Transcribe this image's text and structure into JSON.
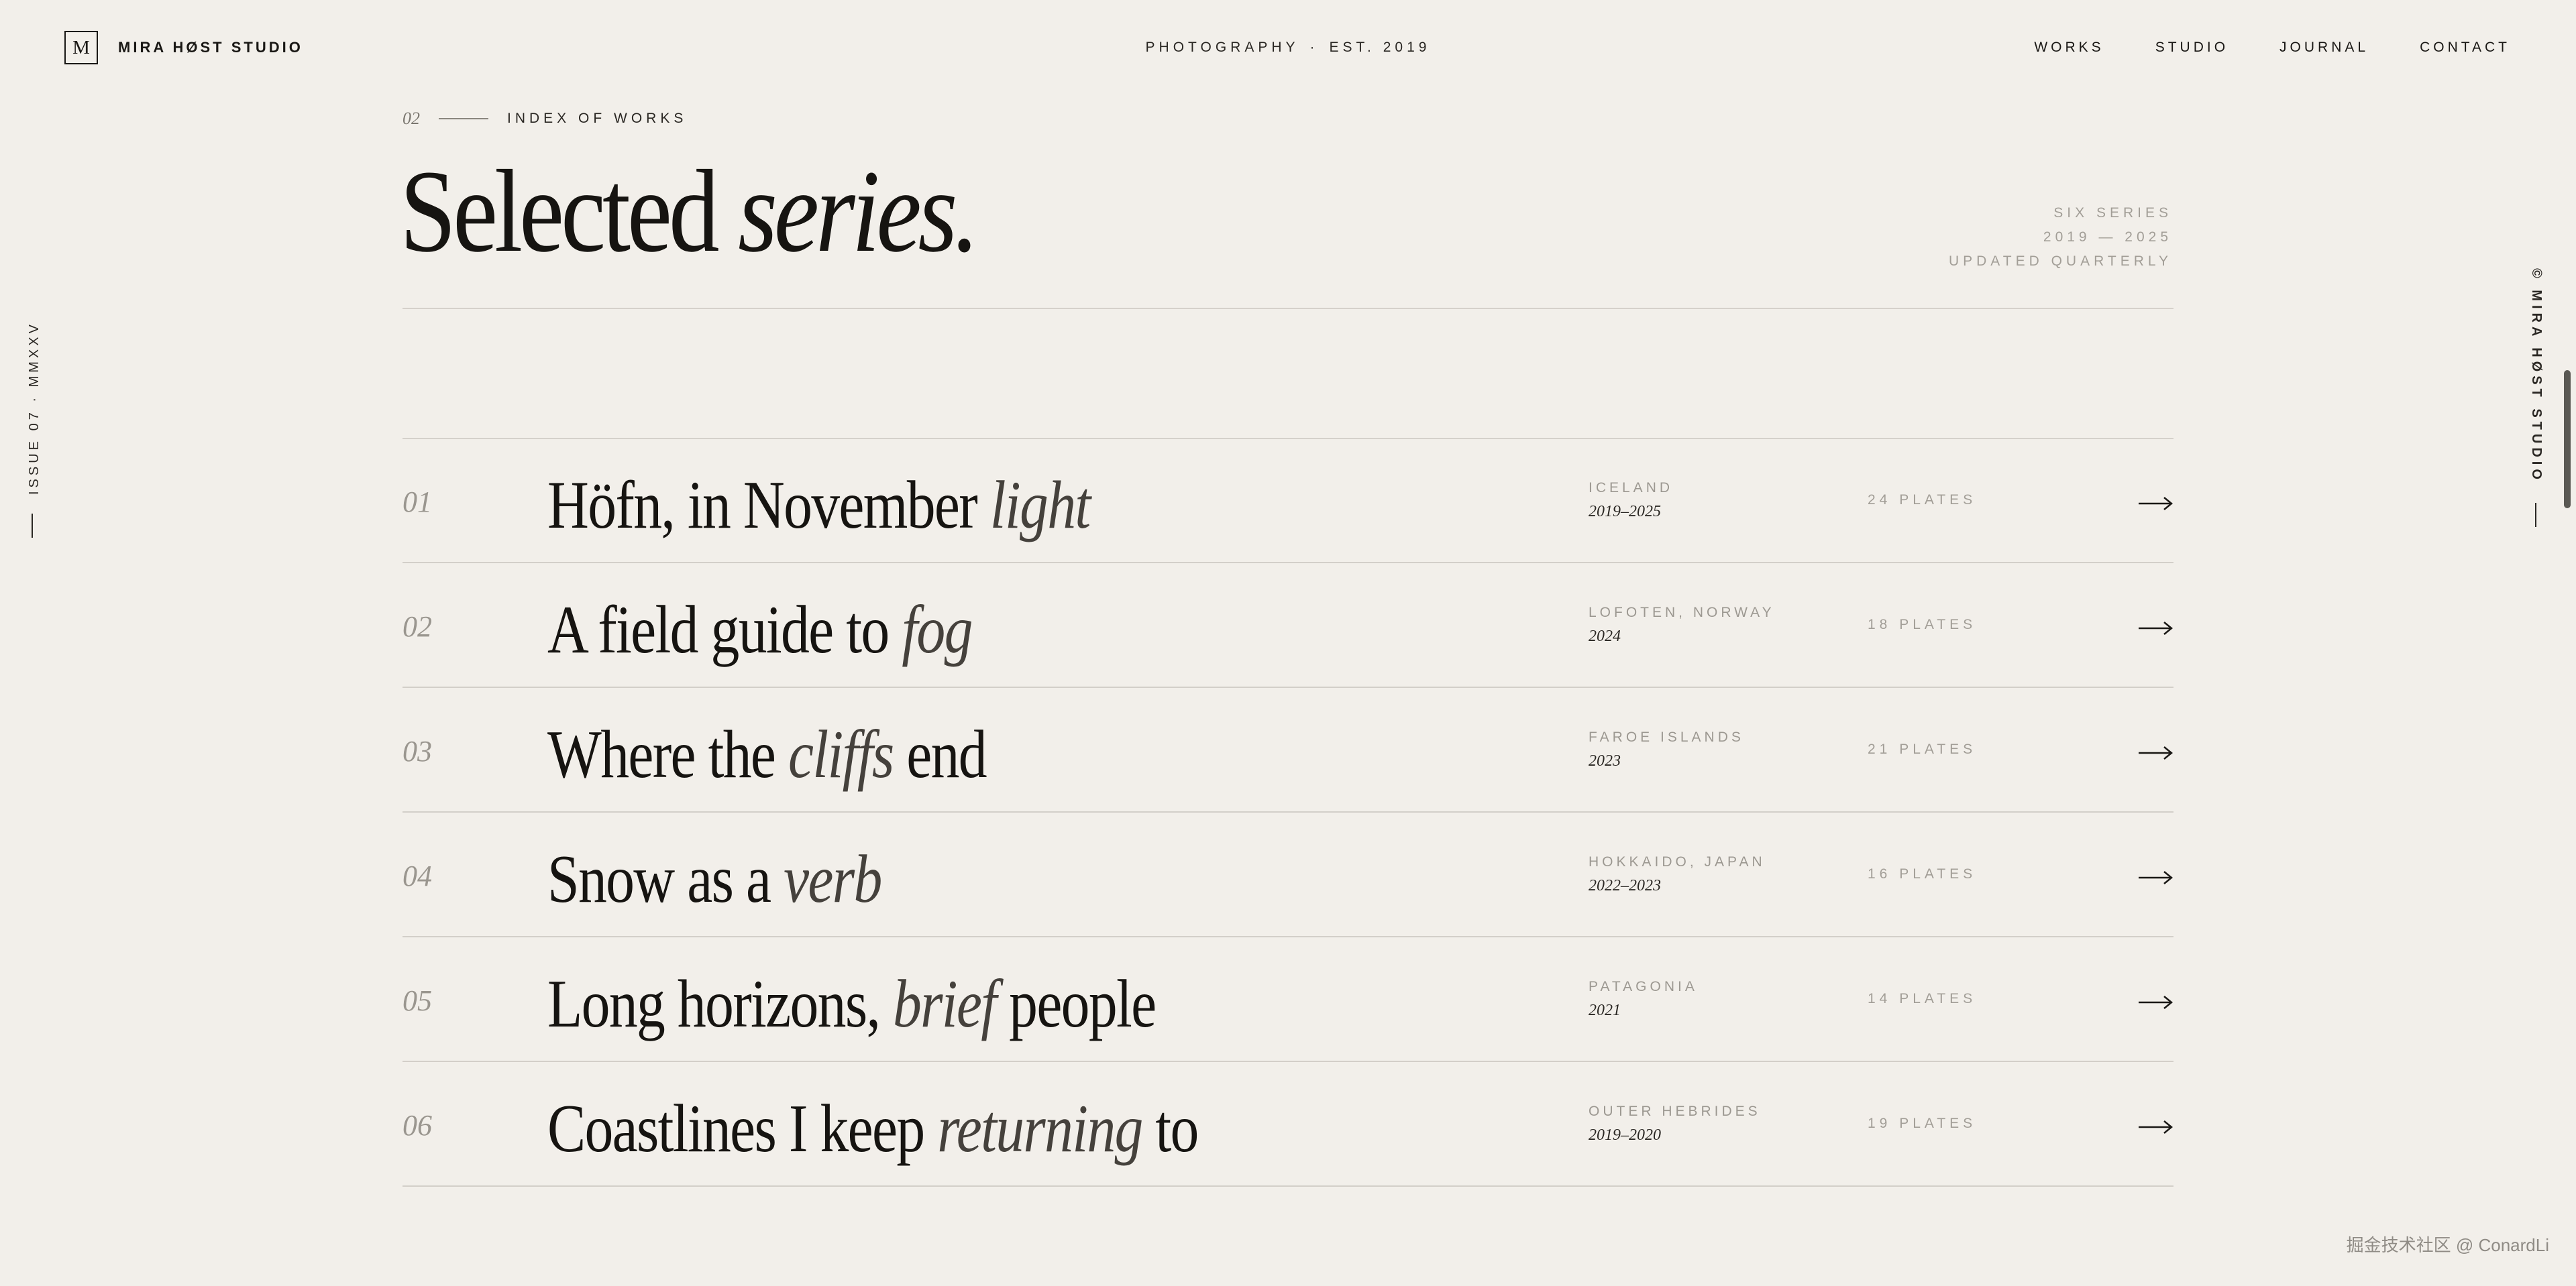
{
  "header": {
    "logo_letter": "M",
    "brand": "MIRA HØST STUDIO",
    "tagline_left": "PHOTOGRAPHY",
    "tagline_sep": "·",
    "tagline_right": "EST. 2019",
    "nav": [
      "WORKS",
      "STUDIO",
      "JOURNAL",
      "CONTACT"
    ]
  },
  "rails": {
    "left": "ISSUE 07 · MMXXV",
    "right": "© MIRA HØST STUDIO"
  },
  "intro": {
    "eyebrow_number": "02",
    "eyebrow_label": "INDEX OF WORKS",
    "title_plain": "Selected",
    "title_italic": "series.",
    "meta": [
      "SIX SERIES",
      "2019 — 2025",
      "UPDATED QUARTERLY"
    ]
  },
  "works": [
    {
      "num": "01",
      "parts": [
        {
          "t": "Höfn, in November ",
          "i": false
        },
        {
          "t": "light",
          "i": true
        }
      ],
      "location": "ICELAND",
      "years": "2019–2025",
      "plates": "24 PLATES"
    },
    {
      "num": "02",
      "parts": [
        {
          "t": "A field guide to ",
          "i": false
        },
        {
          "t": "fog",
          "i": true
        }
      ],
      "location": "LOFOTEN, NORWAY",
      "years": "2024",
      "plates": "18 PLATES"
    },
    {
      "num": "03",
      "parts": [
        {
          "t": "Where the ",
          "i": false
        },
        {
          "t": "cliffs",
          "i": true
        },
        {
          "t": " end",
          "i": false
        }
      ],
      "location": "FAROE ISLANDS",
      "years": "2023",
      "plates": "21 PLATES"
    },
    {
      "num": "04",
      "parts": [
        {
          "t": "Snow as a ",
          "i": false
        },
        {
          "t": "verb",
          "i": true
        }
      ],
      "location": "HOKKAIDO, JAPAN",
      "years": "2022–2023",
      "plates": "16 PLATES"
    },
    {
      "num": "05",
      "parts": [
        {
          "t": "Long horizons, ",
          "i": false
        },
        {
          "t": "brief",
          "i": true
        },
        {
          "t": " people",
          "i": false
        }
      ],
      "location": "PATAGONIA",
      "years": "2021",
      "plates": "14 PLATES"
    },
    {
      "num": "06",
      "parts": [
        {
          "t": "Coastlines I keep ",
          "i": false
        },
        {
          "t": "returning",
          "i": true
        },
        {
          "t": " to",
          "i": false
        }
      ],
      "location": "OUTER HEBRIDES",
      "years": "2019–2020",
      "plates": "19 PLATES"
    }
  ],
  "row_action_icon": "arrow-right-icon",
  "watermark": "掘金技术社区 @ ConardLi",
  "colors": {
    "background": "#f2efea",
    "ink": "#161411",
    "muted": "#a29e97",
    "rule": "#d3cfc9"
  }
}
